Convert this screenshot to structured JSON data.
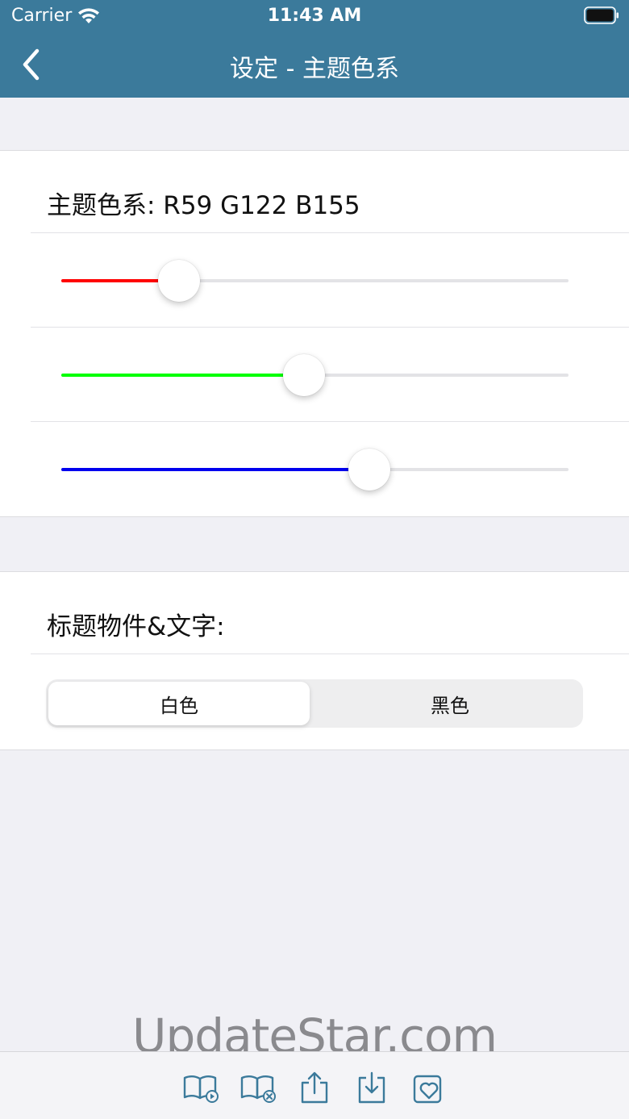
{
  "status_bar": {
    "carrier": "Carrier",
    "time": "11:43 AM"
  },
  "nav": {
    "title": "设定 - 主题色系",
    "back_icon": "chevron-left-icon"
  },
  "theme_color": {
    "label": "主题色系: R59 G122 B155",
    "sliders": [
      {
        "name": "red",
        "value": 59,
        "max": 255,
        "color": "#ff0000"
      },
      {
        "name": "green",
        "value": 122,
        "max": 255,
        "color": "#00ff00"
      },
      {
        "name": "blue",
        "value": 155,
        "max": 255,
        "color": "#0000ee"
      }
    ]
  },
  "title_text": {
    "label": "标题物件&文字:",
    "options": [
      "白色",
      "黑色"
    ],
    "selected": "白色"
  },
  "watermark": "UpdateStar.com",
  "toolbar": {
    "buttons": [
      "book-play-icon",
      "book-remove-icon",
      "share-upload-icon",
      "download-icon",
      "favorite-heart-icon"
    ]
  },
  "colors": {
    "header": "#3b7a9b",
    "toolbar_icon": "#3b7a9b",
    "background": "#f0f0f5"
  }
}
